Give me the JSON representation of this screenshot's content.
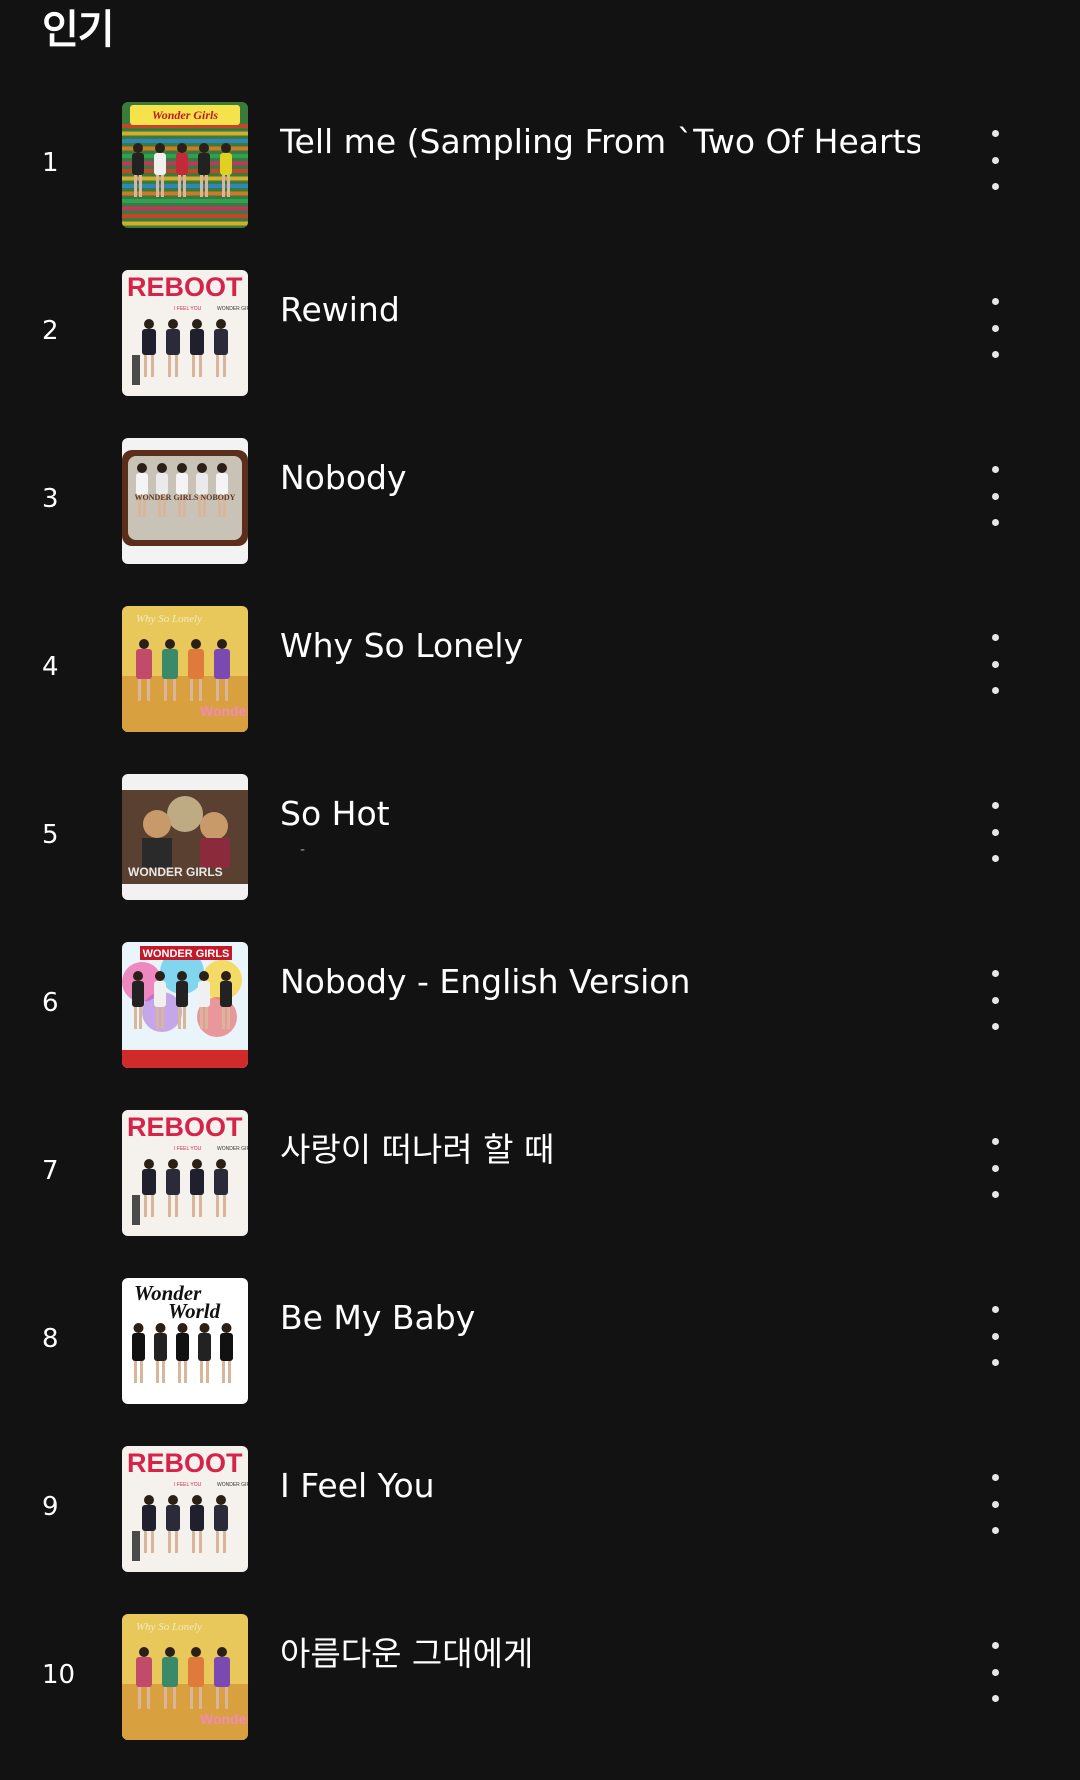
{
  "section": {
    "title": "인기"
  },
  "more_icon": "more-vertical-icon",
  "tracks": [
    {
      "rank": "1",
      "title": "Tell me (Sampling From `Two Of Hearts`)",
      "subtitle": "",
      "cover": "tellme",
      "cover_icon": "album-cover-tell-me"
    },
    {
      "rank": "2",
      "title": "Rewind",
      "subtitle": "",
      "cover": "reboot",
      "cover_icon": "album-cover-reboot"
    },
    {
      "rank": "3",
      "title": "Nobody",
      "subtitle": "",
      "cover": "nobody",
      "cover_icon": "album-cover-nobody"
    },
    {
      "rank": "4",
      "title": "Why So Lonely",
      "subtitle": "",
      "cover": "lonely",
      "cover_icon": "album-cover-why-so-lonely"
    },
    {
      "rank": "5",
      "title": "So Hot",
      "subtitle": "-",
      "cover": "sohot",
      "cover_icon": "album-cover-so-hot"
    },
    {
      "rank": "6",
      "title": "Nobody - English Version",
      "subtitle": "",
      "cover": "english",
      "cover_icon": "album-cover-nobody-english"
    },
    {
      "rank": "7",
      "title": "사랑이 떠나려 할 때",
      "subtitle": "",
      "cover": "reboot",
      "cover_icon": "album-cover-reboot"
    },
    {
      "rank": "8",
      "title": "Be My Baby",
      "subtitle": "",
      "cover": "wonderworld",
      "cover_icon": "album-cover-wonder-world"
    },
    {
      "rank": "9",
      "title": "I Feel You",
      "subtitle": "",
      "cover": "reboot",
      "cover_icon": "album-cover-reboot"
    },
    {
      "rank": "10",
      "title": "아름다운 그대에게",
      "subtitle": "",
      "cover": "lonely",
      "cover_icon": "album-cover-why-so-lonely"
    }
  ],
  "covers": {
    "reboot": {
      "text_main": "REBOOT",
      "text_sub": "WONDER GIRLS",
      "text_tag": "I FEEL YOU"
    },
    "lonely": {
      "text_main": "Why So Lonely",
      "text_sub": "WONDER GIRLS"
    },
    "tellme": {
      "text_main": "Wonder Girls"
    },
    "nobody": {
      "text_main": "WONDER GIRLS NOBODY"
    },
    "sohot": {
      "text_main": "WONDER GIRLS"
    },
    "english": {
      "text_main": "WONDER GIRLS"
    },
    "wonderworld": {
      "text_main": "Wonder",
      "text_sub": "World"
    }
  }
}
